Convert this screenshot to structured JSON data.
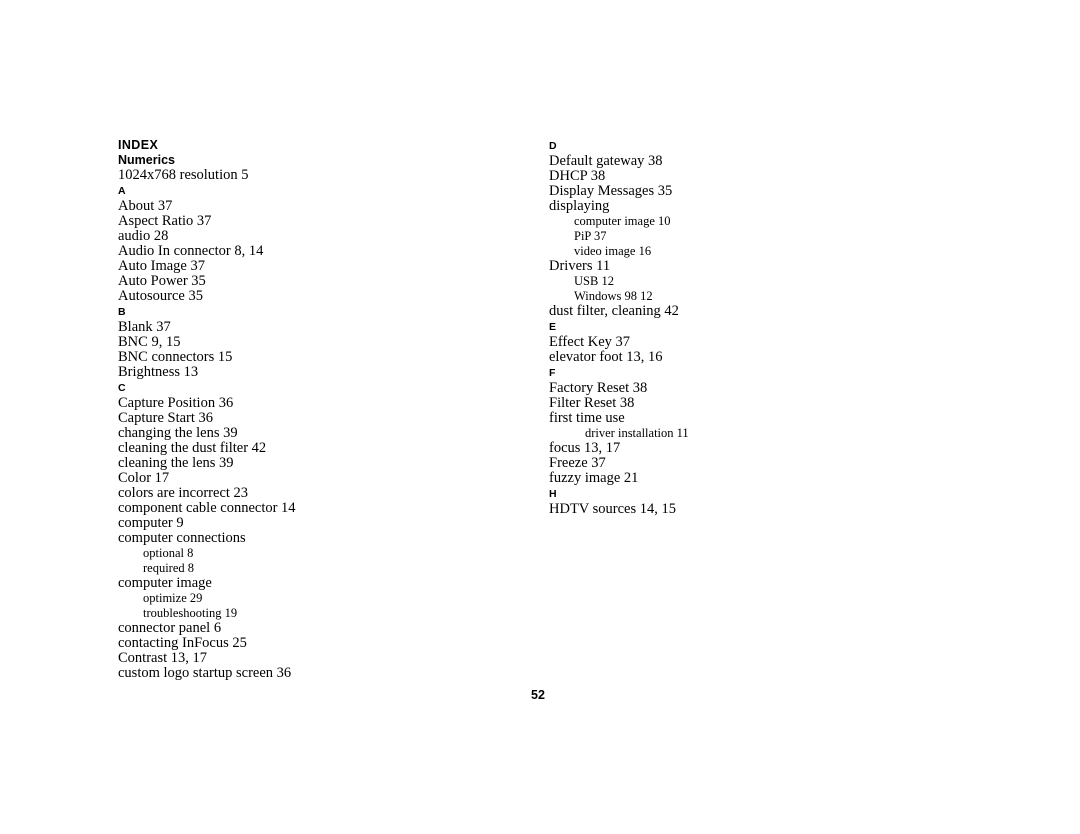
{
  "document": {
    "index_title": "INDEX",
    "page_number": "52"
  },
  "left_column": {
    "blocks": [
      {
        "kind": "section-title",
        "text": "Numerics"
      },
      {
        "kind": "entry",
        "text": "1024x768 resolution 5"
      },
      {
        "kind": "letter",
        "text": "A"
      },
      {
        "kind": "entry",
        "text": "About 37"
      },
      {
        "kind": "entry",
        "text": "Aspect Ratio 37"
      },
      {
        "kind": "entry",
        "text": "audio 28"
      },
      {
        "kind": "entry",
        "text": "Audio In connector 8, 14"
      },
      {
        "kind": "entry",
        "text": "Auto Image 37"
      },
      {
        "kind": "entry",
        "text": "Auto Power 35"
      },
      {
        "kind": "entry",
        "text": "Autosource 35"
      },
      {
        "kind": "letter",
        "text": "B"
      },
      {
        "kind": "entry",
        "text": "Blank 37"
      },
      {
        "kind": "entry",
        "text": "BNC 9, 15"
      },
      {
        "kind": "entry",
        "text": "BNC connectors 15"
      },
      {
        "kind": "entry",
        "text": "Brightness 13"
      },
      {
        "kind": "letter",
        "text": "C"
      },
      {
        "kind": "entry",
        "text": "Capture Position 36"
      },
      {
        "kind": "entry",
        "text": "Capture Start 36"
      },
      {
        "kind": "entry",
        "text": "changing the lens 39"
      },
      {
        "kind": "entry",
        "text": "cleaning the dust filter 42"
      },
      {
        "kind": "entry",
        "text": "cleaning the lens 39"
      },
      {
        "kind": "entry",
        "text": "Color 17"
      },
      {
        "kind": "entry",
        "text": "colors are incorrect 23"
      },
      {
        "kind": "entry",
        "text": "component cable connector 14"
      },
      {
        "kind": "entry",
        "text": "computer 9"
      },
      {
        "kind": "entry",
        "text": "computer connections"
      },
      {
        "kind": "sub",
        "text": "optional 8"
      },
      {
        "kind": "sub",
        "text": "required 8"
      },
      {
        "kind": "entry",
        "text": "computer image"
      },
      {
        "kind": "sub",
        "text": "optimize 29"
      },
      {
        "kind": "sub",
        "text": "troubleshooting 19"
      },
      {
        "kind": "entry",
        "text": "connector panel 6"
      },
      {
        "kind": "entry",
        "text": "contacting InFocus 25"
      },
      {
        "kind": "entry",
        "text": "Contrast 13, 17"
      },
      {
        "kind": "entry",
        "text": "custom logo startup screen 36"
      }
    ]
  },
  "right_column": {
    "blocks": [
      {
        "kind": "letter",
        "text": "D"
      },
      {
        "kind": "entry",
        "text": "Default gateway 38"
      },
      {
        "kind": "entry",
        "text": "DHCP 38"
      },
      {
        "kind": "entry",
        "text": "Display Messages 35"
      },
      {
        "kind": "entry",
        "text": "displaying"
      },
      {
        "kind": "sub",
        "text": "computer image 10"
      },
      {
        "kind": "sub",
        "text": "PiP 37"
      },
      {
        "kind": "sub",
        "text": "video image 16"
      },
      {
        "kind": "entry",
        "text": "Drivers 11"
      },
      {
        "kind": "sub",
        "text": "USB 12"
      },
      {
        "kind": "sub",
        "text": "Windows 98 12"
      },
      {
        "kind": "entry",
        "text": "dust filter, cleaning 42"
      },
      {
        "kind": "letter",
        "text": "E"
      },
      {
        "kind": "entry",
        "text": "Effect Key 37"
      },
      {
        "kind": "entry",
        "text": "elevator foot 13, 16"
      },
      {
        "kind": "letter",
        "text": "F"
      },
      {
        "kind": "entry",
        "text": "Factory Reset 38"
      },
      {
        "kind": "entry",
        "text": "Filter Reset 38"
      },
      {
        "kind": "entry",
        "text": "first time use"
      },
      {
        "kind": "sub2",
        "text": "driver installation 11"
      },
      {
        "kind": "entry",
        "text": "focus 13, 17"
      },
      {
        "kind": "entry",
        "text": "Freeze 37"
      },
      {
        "kind": "entry",
        "text": "fuzzy image 21"
      },
      {
        "kind": "letter",
        "text": "H"
      },
      {
        "kind": "entry",
        "text": "HDTV sources 14, 15"
      }
    ]
  }
}
